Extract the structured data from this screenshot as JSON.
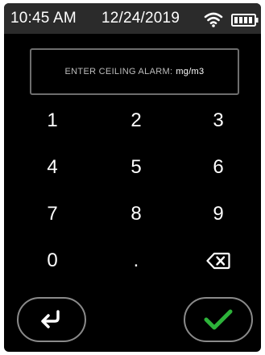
{
  "status_bar": {
    "time": "10:45 AM",
    "date": "12/24/2019",
    "wifi_icon": "wifi-icon",
    "battery_icon": "battery-full-icon"
  },
  "entry": {
    "prompt": "ENTER CEILING ALARM:",
    "unit": "mg/m3",
    "value": ""
  },
  "keypad": {
    "keys": [
      "1",
      "2",
      "3",
      "4",
      "5",
      "6",
      "7",
      "8",
      "9",
      "0",
      "."
    ],
    "backspace_icon": "backspace-icon"
  },
  "actions": {
    "back_icon": "return-arrow-icon",
    "confirm_icon": "checkmark-icon",
    "confirm_color": "#2db33a"
  }
}
